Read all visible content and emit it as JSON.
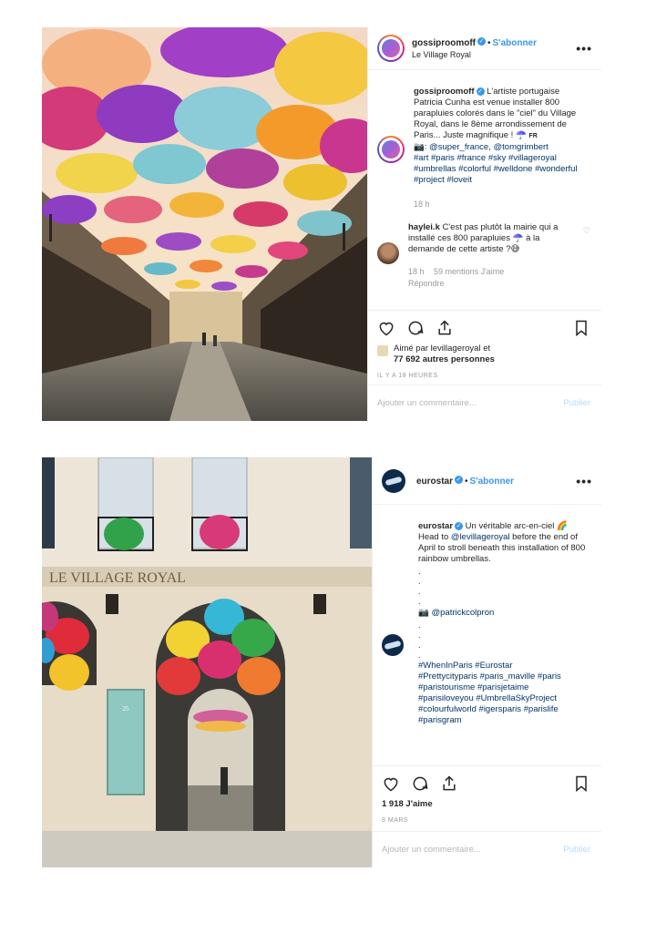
{
  "post1": {
    "username": "gossiproomoff",
    "follow_label": "S'abonner",
    "location": "Le Village Royal",
    "caption_user": "gossiproomoff",
    "caption_text": "L'artiste portugaise Patricia Cunha est venue installer 800 parapluies colorés dans le \"ciel\" du Village Royal, dans le 8ème arrondissement de Paris... Juste magnifique ! ☂️",
    "caption_flag": "FR",
    "caption_credit_icon": "📷",
    "caption_credit": ": @super_france, @tomgrimbert",
    "caption_tags": "#art #paris #france #sky #villageroyal #umbrellas #colorful #welldone #wonderful #project #loveit",
    "caption_time": "18 h",
    "comment_user": "haylei.k",
    "comment_text": "C'est pas plutôt la mairie qui a installé ces 800 parapluies ☂️ à la demande de cette artiste ?😅",
    "comment_time": "18 h",
    "comment_likes": "59 mentions J'aime",
    "comment_reply": "Répondre",
    "liked_by_prefix": "Aimé par",
    "liked_by_user": "levillageroyal",
    "liked_by_suffix": "et",
    "liked_by_others": "77 692 autres personnes",
    "timestamp": "IL Y A 18 HEURES",
    "comment_placeholder": "Ajouter un commentaire...",
    "publish_label": "Publier"
  },
  "post2": {
    "username": "eurostar",
    "follow_label": "S'abonner",
    "caption_user": "eurostar",
    "caption_text": "Un véritable arc-en-ciel 🌈 Head to",
    "caption_mention": "@levillageroyal",
    "caption_text2": "before the end of April to stroll beneath this installation of 800 rainbow umbrellas.",
    "dots_a": ".\n.\n.\n.",
    "credit_icon": "📷",
    "credit": "@patrickcolpron",
    "dots_b": ".\n.\n.\n.",
    "tags": "#WhenInParis #Eurostar #Prettycityparis #paris_maville #paris #paristourisme #parisjetaime #parisiloveyou #UmbrellaSkyProject #colourfulworld #igersparis #parislife #parisgram",
    "likes": "1 918 J'aime",
    "timestamp": "8 MARS",
    "comment_placeholder": "Ajouter un commentaire...",
    "publish_label": "Publier",
    "sign_text": "LE VILLAGE ROYAL",
    "plaque_text": "25 Village Royal"
  },
  "colors": {
    "link": "#3897f0",
    "hashtag": "#003569",
    "muted": "#999999",
    "border": "#efefef"
  },
  "icons": [
    "heart-icon",
    "comment-icon",
    "share-icon",
    "bookmark-icon",
    "more-icon",
    "verified-icon"
  ]
}
